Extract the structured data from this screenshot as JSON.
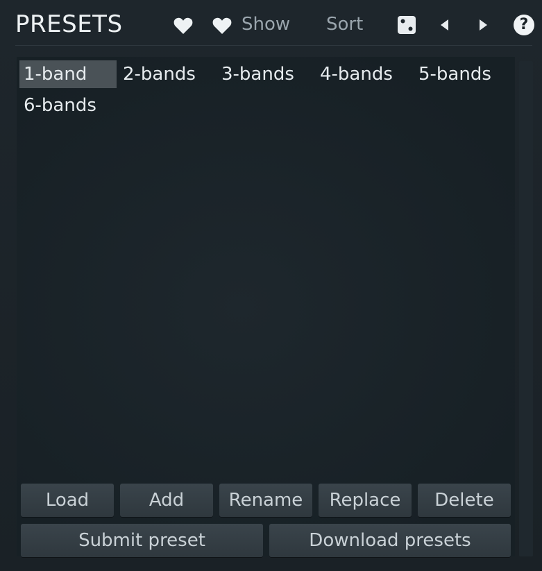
{
  "header": {
    "title": "PRESETS",
    "show_label": "Show",
    "sort_label": "Sort",
    "help_symbol": "?"
  },
  "icons": {
    "favorite": "heart-icon",
    "show_favorites": "heart-icon",
    "random": "dice-icon",
    "previous": "triangle-left-icon",
    "next": "triangle-right-icon",
    "help": "help-icon"
  },
  "presets": [
    {
      "label": "1-band",
      "selected": true
    },
    {
      "label": "2-bands",
      "selected": false
    },
    {
      "label": "3-bands",
      "selected": false
    },
    {
      "label": "4-bands",
      "selected": false
    },
    {
      "label": "5-bands",
      "selected": false
    },
    {
      "label": "6-bands",
      "selected": false
    }
  ],
  "actions": {
    "load": "Load",
    "add": "Add",
    "rename": "Rename",
    "replace": "Replace",
    "delete": "Delete",
    "submit": "Submit preset",
    "download": "Download presets"
  },
  "colors": {
    "background": "#1b2227",
    "selected": "#4a5257",
    "button": "#353f45",
    "text": "#e6ebee"
  }
}
